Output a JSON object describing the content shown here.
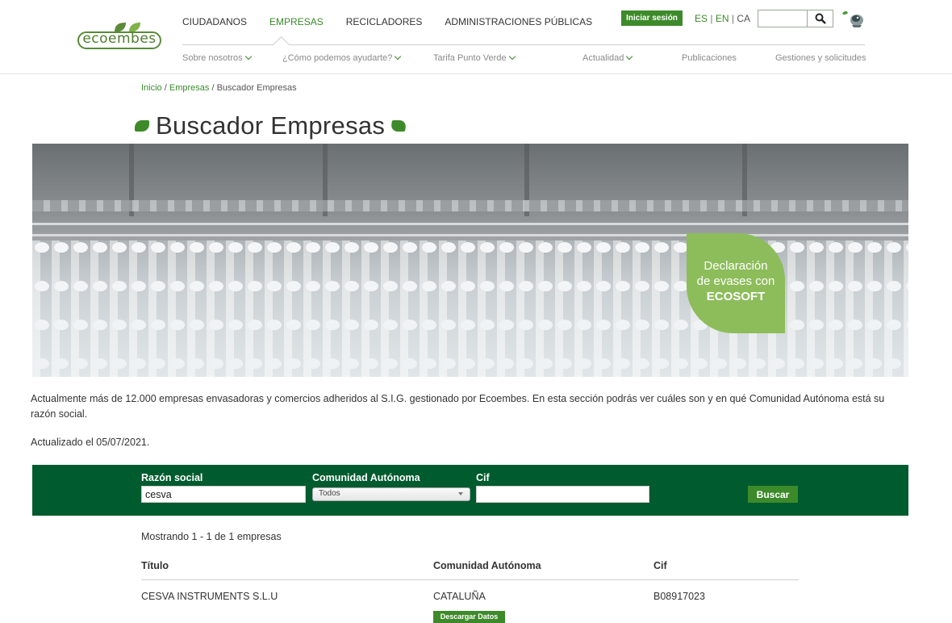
{
  "brand": {
    "logo_text": "ecoembes",
    "green": "#3d8a2a",
    "dark_green": "#005b2e",
    "leaf_green": "#8cbd5a"
  },
  "header": {
    "main_nav": [
      "CIUDADANOS",
      "EMPRESAS",
      "RECICLADORES",
      "ADMINISTRACIONES PÚBLICAS"
    ],
    "active_nav": "EMPRESAS",
    "login_label": "Iniciar sesión",
    "languages": {
      "es": "ES",
      "en": "EN",
      "ca": "CA"
    },
    "search_value": "",
    "search_icon": "search-icon",
    "eco_icon": "recycling-mascot-icon"
  },
  "sub_nav": [
    {
      "label": "Sobre nosotros",
      "has_dropdown": true
    },
    {
      "label": "¿Cómo podemos ayudarte?",
      "has_dropdown": true
    },
    {
      "label": "Tarifa Punto Verde",
      "has_dropdown": true
    },
    {
      "label": "Actualidad",
      "has_dropdown": true
    },
    {
      "label": "Publicaciones",
      "has_dropdown": false
    },
    {
      "label": "Gestiones y solicitudes",
      "has_dropdown": false
    }
  ],
  "breadcrumb": {
    "home": "Inicio",
    "section": "Empresas",
    "current": "Buscador Empresas",
    "separator": "/"
  },
  "page": {
    "title": "Buscador Empresas"
  },
  "banner": {
    "badge_line1": "Declaración",
    "badge_line2": "de evases con",
    "badge_line3": "ECOSOFT"
  },
  "intro": {
    "text": "Actualmente más de 12.000 empresas envasadoras y comercios adheridos al S.I.G. gestionado por Ecoembes. En esta sección podrás ver cuáles son y en qué Comunidad Autónoma está su razón social.",
    "updated": "Actualizado el 05/07/2021."
  },
  "search_form": {
    "razon_label": "Razón social",
    "razon_value": "cesva",
    "comunidad_label": "Comunidad Autónoma",
    "comunidad_selected": "Todos",
    "cif_label": "Cif",
    "cif_value": "",
    "submit_label": "Buscar"
  },
  "results": {
    "summary": "Mostrando 1 - 1 de 1 empresas",
    "columns": [
      "Título",
      "Comunidad Autónoma",
      "Cif"
    ],
    "rows": [
      {
        "titulo": "CESVA INSTRUMENTS S.L.U",
        "comunidad": "CATALUÑA",
        "cif": "B08917023"
      }
    ],
    "download_label": "Descargar Datos"
  }
}
